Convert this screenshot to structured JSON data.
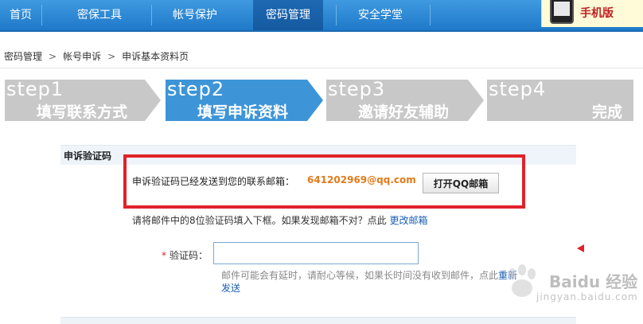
{
  "nav": {
    "items": [
      {
        "label": "首页"
      },
      {
        "label": "密保工具"
      },
      {
        "label": "帐号保护"
      },
      {
        "label": "密码管理"
      },
      {
        "label": "安全学堂"
      }
    ],
    "active_index": 3,
    "badge_label": "手机版"
  },
  "breadcrumb": [
    "密码管理",
    "帐号申诉",
    "申诉基本资料页"
  ],
  "steps": [
    {
      "num": "step1",
      "title": "填写联系方式",
      "state": "done"
    },
    {
      "num": "step2",
      "title": "填写申诉资料",
      "state": "active"
    },
    {
      "num": "step3",
      "title": "邀请好友辅助",
      "state": "pending"
    },
    {
      "num": "step4",
      "title": "完成",
      "state": "pending"
    }
  ],
  "section": {
    "title": "申诉验证码",
    "sent_text": "申诉验证码已经发送到您的联系邮箱：",
    "email": "641202969@qq.com",
    "open_button": "打开QQ邮箱",
    "hint_prefix": "请将邮件中的8位验证码填入下框。如果发现邮箱不对？点此",
    "hint_link": "更改邮箱",
    "field_label": "验证码：",
    "field_value": "",
    "note_text": "邮件可能会有延时，请耐心等候，如果长时间没有收到邮件，点此",
    "note_link_1": "重新",
    "note_link_2": "发送"
  },
  "watermark": {
    "text": "Baidu 经验",
    "sub": "jingyan.baidu.com"
  },
  "colors": {
    "nav": "#2a86d6",
    "step_active": "#3d95d8",
    "step_inactive": "#c8c8c8",
    "alert": "#e0222a",
    "email": "#e07b1a",
    "link": "#1a5fb4"
  }
}
